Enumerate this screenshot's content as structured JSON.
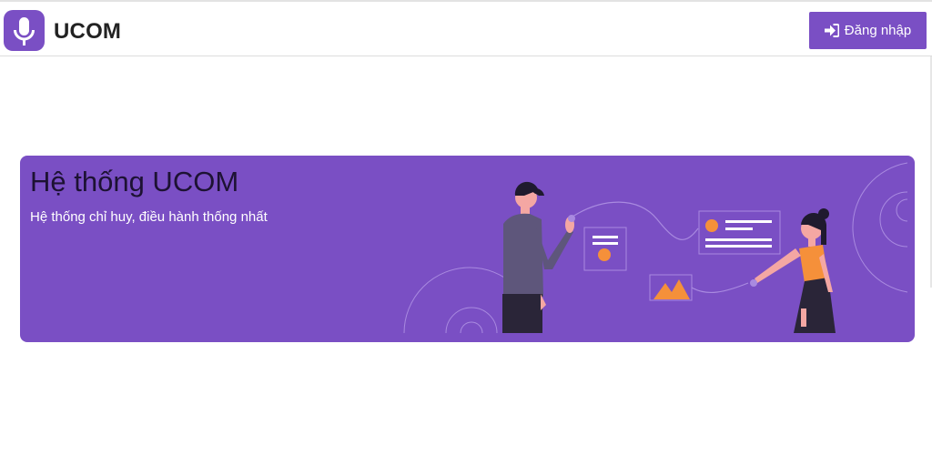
{
  "header": {
    "brand": "UCOM",
    "logo_icon": "microphone-icon",
    "login_label": "Đăng nhập",
    "login_icon": "sign-in-icon"
  },
  "hero": {
    "title": "Hệ thống UCOM",
    "subtitle": "Hệ thống chỉ huy, điều hành thống nhất",
    "illustration": "presentation-illustration"
  },
  "colors": {
    "accent": "#7a4fc4",
    "accent_orange": "#f5903a",
    "dark": "#2d2a3e"
  }
}
